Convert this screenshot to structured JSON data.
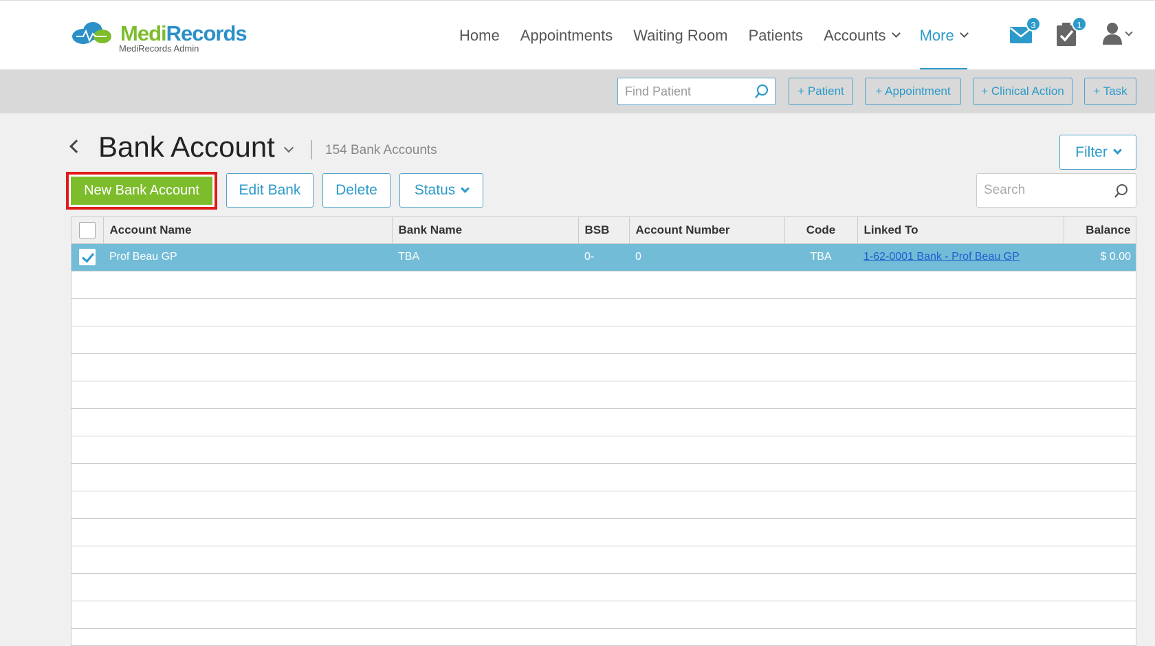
{
  "brand": {
    "name_part1": "Medi",
    "name_part2": "Records",
    "subtitle": "MediRecords Admin",
    "color_green": "#7dbd2c",
    "color_blue": "#2b8fc8"
  },
  "nav": {
    "items": [
      {
        "label": "Home",
        "has_dropdown": false
      },
      {
        "label": "Appointments",
        "has_dropdown": false
      },
      {
        "label": "Waiting Room",
        "has_dropdown": false
      },
      {
        "label": "Patients",
        "has_dropdown": false
      },
      {
        "label": "Accounts",
        "has_dropdown": true
      },
      {
        "label": "More",
        "has_dropdown": true,
        "active": true
      }
    ],
    "mail_badge": "3",
    "tasks_badge": "1",
    "icons": [
      "envelope-icon",
      "clipboard-check-icon",
      "user-icon"
    ]
  },
  "actionbar": {
    "find_patient_placeholder": "Find Patient",
    "buttons": [
      "+ Patient",
      "+ Appointment",
      "+ Clinical Action",
      "+ Task"
    ]
  },
  "page": {
    "title": "Bank Account",
    "count": "154 Bank Accounts",
    "filter_label": "Filter"
  },
  "toolbar": {
    "new_label": "New Bank Account",
    "edit_label": "Edit Bank",
    "delete_label": "Delete",
    "status_label": "Status",
    "search_placeholder": "Search"
  },
  "table": {
    "columns": [
      "Account Name",
      "Bank Name",
      "BSB",
      "Account Number",
      "Code",
      "Linked To",
      "Balance"
    ],
    "rows": [
      {
        "selected": true,
        "account_name": "Prof Beau GP",
        "bank_name": "TBA",
        "bsb": "0-",
        "account_number": "0",
        "code": "TBA",
        "linked_to": "1-62-0001 Bank - Prof Beau GP",
        "balance": "$ 0.00"
      }
    ]
  },
  "colors": {
    "accent": "#2b9ac9",
    "selected_row": "#72bcd7",
    "primary_button": "#7dbd2c",
    "highlight_border": "#e01b1b"
  }
}
